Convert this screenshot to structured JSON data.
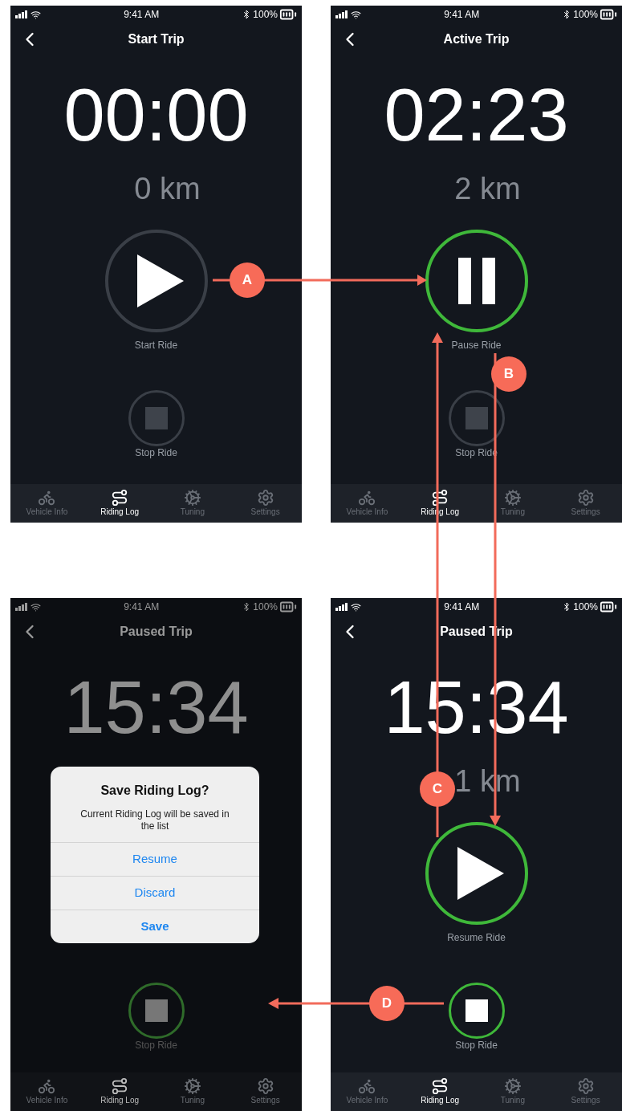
{
  "screens": [
    {
      "status": {
        "time": "9:41 AM",
        "battery": "100%"
      },
      "title": "Start Trip",
      "dimmed": false,
      "time": "00:00",
      "distance": "0 km",
      "main_button": {
        "kind": "play",
        "active": false,
        "label": "Start Ride"
      },
      "stop_button": {
        "active": false,
        "label": "Stop Ride"
      },
      "tabs": [
        {
          "label": "Vehicle Info",
          "selected": false
        },
        {
          "label": "Riding Log",
          "selected": true
        },
        {
          "label": "Tuning",
          "selected": false
        },
        {
          "label": "Settings",
          "selected": false
        }
      ]
    },
    {
      "status": {
        "time": "9:41 AM",
        "battery": "100%"
      },
      "title": "Active Trip",
      "dimmed": false,
      "time": "02:23",
      "distance": "2 km",
      "main_button": {
        "kind": "pause",
        "active": true,
        "label": "Pause Ride"
      },
      "stop_button": {
        "active": false,
        "label": "Stop Ride"
      },
      "tabs": [
        {
          "label": "Vehicle Info",
          "selected": false
        },
        {
          "label": "Riding Log",
          "selected": true
        },
        {
          "label": "Tuning",
          "selected": false
        },
        {
          "label": "Settings",
          "selected": false
        }
      ]
    },
    {
      "status": {
        "time": "9:41 AM",
        "battery": "100%"
      },
      "title": "Paused Trip",
      "dimmed": true,
      "time": "15:34",
      "stop_button": {
        "active": true,
        "label": "Stop Ride"
      },
      "tabs": [
        {
          "label": "Vehicle Info",
          "selected": false
        },
        {
          "label": "Riding Log",
          "selected": true
        },
        {
          "label": "Tuning",
          "selected": false
        },
        {
          "label": "Settings",
          "selected": false
        }
      ],
      "dialog": {
        "title": "Save Riding Log?",
        "message": "Current Riding Log will be saved in the list",
        "actions": [
          {
            "label": "Resume",
            "kind": "normal"
          },
          {
            "label": "Discard",
            "kind": "normal"
          },
          {
            "label": "Save",
            "kind": "primary"
          }
        ]
      }
    },
    {
      "status": {
        "time": "9:41 AM",
        "battery": "100%"
      },
      "title": "Paused Trip",
      "dimmed": false,
      "time": "15:34",
      "distance": "1 km",
      "main_button": {
        "kind": "play",
        "active": true,
        "label": "Resume Ride"
      },
      "stop_button": {
        "active": true,
        "label": "Stop Ride"
      },
      "tabs": [
        {
          "label": "Vehicle Info",
          "selected": false
        },
        {
          "label": "Riding Log",
          "selected": true
        },
        {
          "label": "Tuning",
          "selected": false
        },
        {
          "label": "Settings",
          "selected": false
        }
      ]
    }
  ],
  "flow": [
    {
      "label": "A"
    },
    {
      "label": "B"
    },
    {
      "label": "C"
    },
    {
      "label": "D"
    }
  ]
}
